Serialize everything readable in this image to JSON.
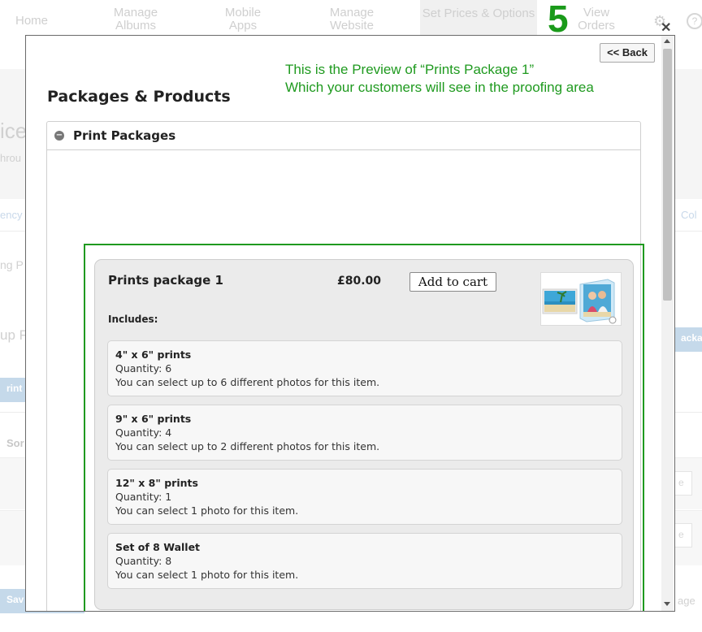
{
  "top_nav": {
    "items": [
      {
        "label": "Home"
      },
      {
        "label": "Manage Albums"
      },
      {
        "label": "Mobile Apps"
      },
      {
        "label": "Manage Website"
      },
      {
        "label": "Set Prices & Options"
      },
      {
        "label": "View Orders"
      }
    ],
    "step_number": "5",
    "step_color": "#1a9a1a"
  },
  "background_fragments": {
    "heading": "ice",
    "subtext": "hrou",
    "tab_left": "ency",
    "tab_right": "Col",
    "pricing": "ng P",
    "setup": "up F",
    "print_pkg_btn": "rint Pa",
    "package_btn": "acka",
    "sort": "Sor",
    "row1_btn": "e",
    "row2_btn": "e",
    "save": "Sav",
    "page": "age"
  },
  "modal": {
    "back_label": "<< Back",
    "annotation": {
      "line1": "This is the Preview of “Prints Package 1”",
      "line2": "Which your customers will see in the proofing area",
      "color": "#1f9a1f"
    },
    "title": "Packages & Products",
    "accordion": {
      "title": "Print Packages",
      "icon": "collapse-circle-icon"
    },
    "package": {
      "name": "Prints package 1",
      "price": "£80.00",
      "add_to_cart_label": "Add to cart",
      "thumbnail_icon": "product-photo-thumbnail",
      "includes_label": "Includes:",
      "items": [
        {
          "title": "4\" x 6\" prints",
          "quantity": "Quantity: 6",
          "note": "You can select up to 6 different photos for this item."
        },
        {
          "title": "9\" x 6\" prints",
          "quantity": "Quantity: 4",
          "note": "You can select up to 2 different photos for this item."
        },
        {
          "title": "12\" x 8\" prints",
          "quantity": "Quantity: 1",
          "note": "You can select 1 photo for this item."
        },
        {
          "title": "Set of 8 Wallet",
          "quantity": "Quantity: 8",
          "note": "You can select 1 photo for this item."
        }
      ]
    }
  },
  "icons": {
    "close": "close-icon",
    "settings": "gear-icon",
    "help": "help-icon"
  }
}
